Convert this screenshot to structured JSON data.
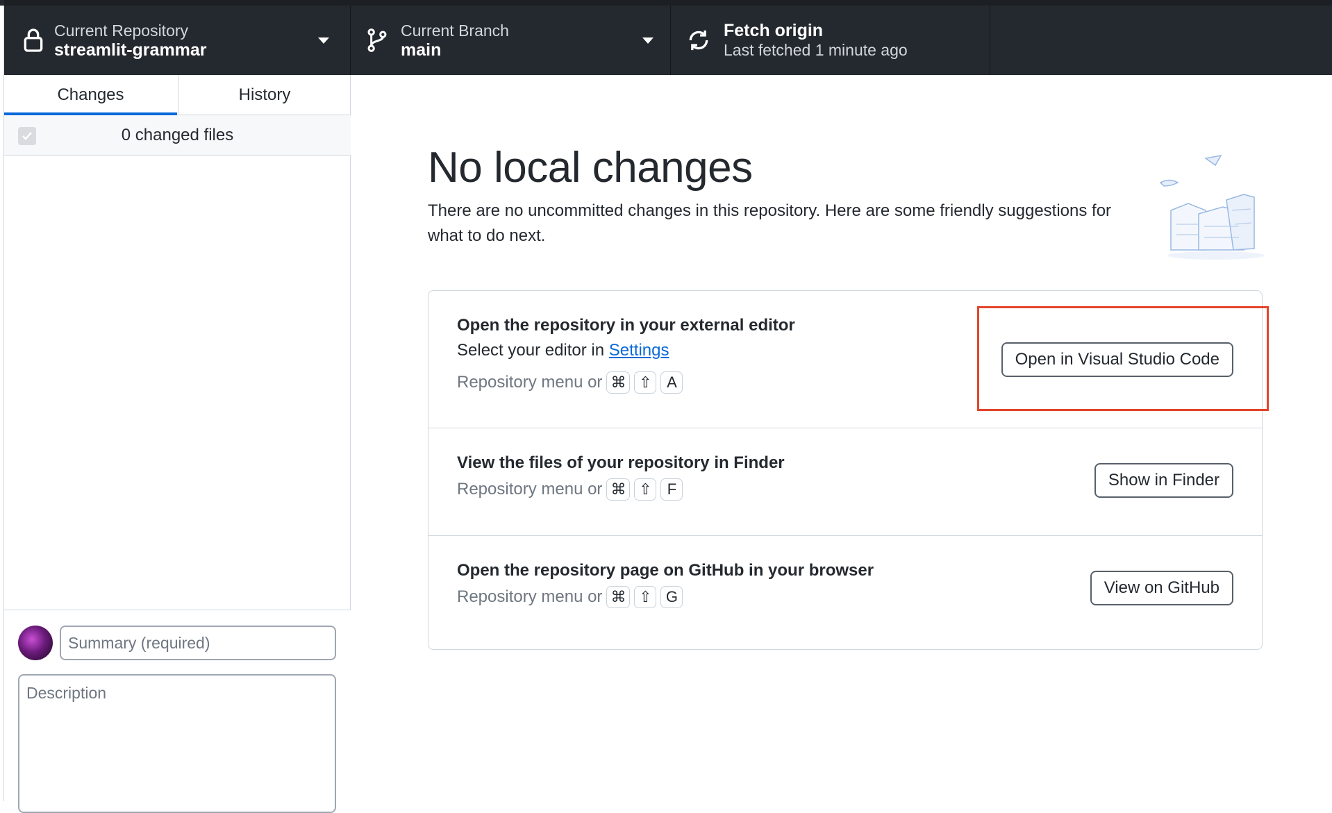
{
  "toolbar": {
    "repository": {
      "label": "Current Repository",
      "value": "streamlit-grammar",
      "icon": "lock-icon"
    },
    "branch": {
      "label": "Current Branch",
      "value": "main",
      "icon": "git-branch-icon"
    },
    "fetch": {
      "title": "Fetch origin",
      "subtitle": "Last fetched 1 minute ago",
      "icon": "sync-icon"
    }
  },
  "sidebar": {
    "tabs": [
      {
        "label": "Changes",
        "active": true
      },
      {
        "label": "History",
        "active": false
      }
    ],
    "changed_files": "0 changed files",
    "commit": {
      "summary_placeholder": "Summary (required)",
      "description_placeholder": "Description"
    }
  },
  "main": {
    "title": "No local changes",
    "description": "There are no uncommitted changes in this repository. Here are some friendly suggestions for what to do next.",
    "actions": [
      {
        "title": "Open the repository in your external editor",
        "subtitle_prefix": "Select your editor in ",
        "subtitle_link": "Settings",
        "shortcut_prefix": "Repository menu or",
        "keys": [
          "⌘",
          "⇧",
          "A"
        ],
        "button": "Open in Visual Studio Code"
      },
      {
        "title": "View the files of your repository in Finder",
        "shortcut_prefix": "Repository menu or",
        "keys": [
          "⌘",
          "⇧",
          "F"
        ],
        "button": "Show in Finder"
      },
      {
        "title": "Open the repository page on GitHub in your browser",
        "shortcut_prefix": "Repository menu or",
        "keys": [
          "⌘",
          "⇧",
          "G"
        ],
        "button": "View on GitHub"
      }
    ]
  },
  "colors": {
    "toolbar_bg": "#24292f",
    "accent": "#0969da",
    "highlight": "#e2452a"
  }
}
